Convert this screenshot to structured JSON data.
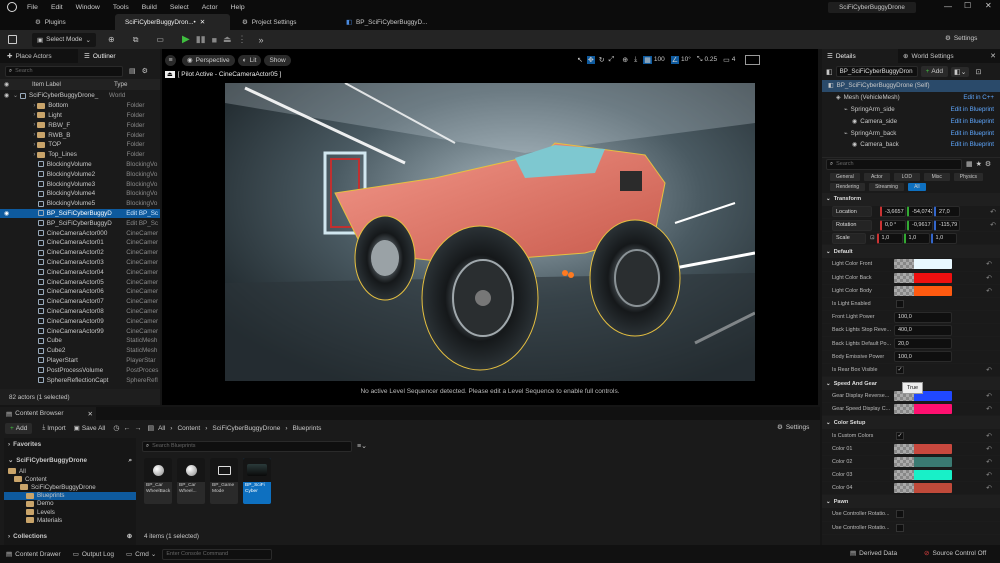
{
  "title_bar": {
    "menu": [
      "File",
      "Edit",
      "Window",
      "Tools",
      "Build",
      "Select",
      "Actor",
      "Help"
    ],
    "project_name": "SciFiCyberBuggyDrone",
    "tabs": [
      {
        "label": "Plugins"
      },
      {
        "label": "SciFiCyberBuggyDron...•"
      },
      {
        "label": "Project Settings"
      },
      {
        "label": "BP_SciFiCyberBuggyD..."
      }
    ]
  },
  "toolbar": {
    "select_mode": "Select Mode",
    "settings": "Settings"
  },
  "left_panel": {
    "tab_place": "Place Actors",
    "tab_outliner": "Outliner",
    "search_placeholder": "Search",
    "col_label": "Item Label",
    "col_type": "Type",
    "rows": [
      {
        "name": "SciFiCyberBuggyDrone_",
        "type": "World",
        "kind": "world",
        "indent": 0,
        "eye": true
      },
      {
        "name": "Bottom",
        "type": "Folder",
        "kind": "folder",
        "indent": 1
      },
      {
        "name": "Light",
        "type": "Folder",
        "kind": "folder",
        "indent": 1
      },
      {
        "name": "RBW_F",
        "type": "Folder",
        "kind": "folder",
        "indent": 1
      },
      {
        "name": "RWB_B",
        "type": "Folder",
        "kind": "folder",
        "indent": 1
      },
      {
        "name": "TOP",
        "type": "Folder",
        "kind": "folder",
        "indent": 1
      },
      {
        "name": "Top_Lines",
        "type": "Folder",
        "kind": "folder",
        "indent": 1
      },
      {
        "name": "BlockingVolume",
        "type": "BlockingVo",
        "kind": "actor",
        "indent": 1
      },
      {
        "name": "BlockingVolume2",
        "type": "BlockingVo",
        "kind": "actor",
        "indent": 1
      },
      {
        "name": "BlockingVolume3",
        "type": "BlockingVo",
        "kind": "actor",
        "indent": 1
      },
      {
        "name": "BlockingVolume4",
        "type": "BlockingVo",
        "kind": "actor",
        "indent": 1
      },
      {
        "name": "BlockingVolume5",
        "type": "BlockingVo",
        "kind": "actor",
        "indent": 1
      },
      {
        "name": "BP_SciFiCyberBuggyD",
        "type": "Edit BP_Sc",
        "kind": "actor",
        "indent": 1,
        "selected": true,
        "eye": true
      },
      {
        "name": "BP_SciFiCyberBuggyD",
        "type": "Edit BP_Sc",
        "kind": "actor",
        "indent": 1
      },
      {
        "name": "CineCameraActor000",
        "type": "CineCamer",
        "kind": "actor",
        "indent": 1
      },
      {
        "name": "CineCameraActor01",
        "type": "CineCamer",
        "kind": "actor",
        "indent": 1
      },
      {
        "name": "CineCameraActor02",
        "type": "CineCamer",
        "kind": "actor",
        "indent": 1
      },
      {
        "name": "CineCameraActor03",
        "type": "CineCamer",
        "kind": "actor",
        "indent": 1
      },
      {
        "name": "CineCameraActor04",
        "type": "CineCamer",
        "kind": "actor",
        "indent": 1
      },
      {
        "name": "CineCameraActor05",
        "type": "CineCamer",
        "kind": "actor",
        "indent": 1
      },
      {
        "name": "CineCameraActor06",
        "type": "CineCamer",
        "kind": "actor",
        "indent": 1
      },
      {
        "name": "CineCameraActor07",
        "type": "CineCamer",
        "kind": "actor",
        "indent": 1
      },
      {
        "name": "CineCameraActor08",
        "type": "CineCamer",
        "kind": "actor",
        "indent": 1
      },
      {
        "name": "CineCameraActor09",
        "type": "CineCamer",
        "kind": "actor",
        "indent": 1
      },
      {
        "name": "CineCameraActor99",
        "type": "CineCamer",
        "kind": "actor",
        "indent": 1
      },
      {
        "name": "Cube",
        "type": "StaticMesh",
        "kind": "actor",
        "indent": 1
      },
      {
        "name": "Cube2",
        "type": "StaticMesh",
        "kind": "actor",
        "indent": 1
      },
      {
        "name": "PlayerStart",
        "type": "PlayerStar",
        "kind": "actor",
        "indent": 1
      },
      {
        "name": "PostProcessVolume",
        "type": "PostProces",
        "kind": "actor",
        "indent": 1
      },
      {
        "name": "SphereReflectionCapt",
        "type": "SphereRefl",
        "kind": "actor",
        "indent": 1
      }
    ],
    "status": "82 actors (1 selected)"
  },
  "viewport": {
    "perspective": "Perspective",
    "lit": "Lit",
    "show": "Show",
    "pilot": "[ Pilot Active - CineCameraActor05 ]",
    "grid": "100",
    "angle": "10°",
    "scale": "0.25",
    "cams": "4",
    "message": "No active Level Sequencer detected. Please edit a Level Sequence to enable full controls."
  },
  "details": {
    "tab_details": "Details",
    "tab_world": "World Settings",
    "actor_name": "BP_SciFiCyberBuggyDron",
    "add": "Add",
    "components": [
      {
        "name": "BP_SciFiCyberBuggyDrone (Self)",
        "link": "",
        "indent": 0,
        "selected": true
      },
      {
        "name": "Mesh (VehicleMesh)",
        "link": "Edit in C++",
        "indent": 1
      },
      {
        "name": "SpringArm_side",
        "link": "Edit in Blueprint",
        "indent": 2
      },
      {
        "name": "Camera_side",
        "link": "Edit in Blueprint",
        "indent": 3
      },
      {
        "name": "SpringArm_back",
        "link": "Edit in Blueprint",
        "indent": 2
      },
      {
        "name": "Camera_back",
        "link": "Edit in Blueprint",
        "indent": 3
      }
    ],
    "search_placeholder": "Search",
    "filters": [
      "General",
      "Actor",
      "LOD",
      "Misc",
      "Physics",
      "Rendering",
      "Streaming",
      "All"
    ],
    "transform_label": "Transform",
    "location": {
      "label": "Location",
      "x": "-3,6657",
      "y": "-54,0742",
      "z": "27,0"
    },
    "rotation": {
      "label": "Rotation",
      "x": "0,0 °",
      "y": "-0,9617 °",
      "z": "-115,79"
    },
    "scale": {
      "label": "Scale",
      "x": "1,0",
      "y": "1,0",
      "z": "1,0"
    },
    "default_label": "Default",
    "default_rows": [
      {
        "label": "Light Color Front",
        "type": "color",
        "color": "#e8f8ff"
      },
      {
        "label": "Light Color Back",
        "type": "color",
        "color": "#f01010"
      },
      {
        "label": "Light Color Body",
        "type": "color",
        "color": "#ff5a10"
      },
      {
        "label": "Is Light Enabled",
        "type": "check",
        "checked": false
      },
      {
        "label": "Front Light Power",
        "type": "num",
        "value": "100,0"
      },
      {
        "label": "Back Lights Stop Reve...",
        "type": "num",
        "value": "400,0"
      },
      {
        "label": "Back Lights Default Po...",
        "type": "num",
        "value": "20,0"
      },
      {
        "label": "Body Emissive Power",
        "type": "num",
        "value": "100,0"
      },
      {
        "label": "Is Rear Box Visible",
        "type": "check",
        "checked": true
      }
    ],
    "tooltip": "True",
    "speed_label": "Speed And Gear",
    "speed_rows": [
      {
        "label": "Gear Display Reverse...",
        "color": "#2048ff"
      },
      {
        "label": "Gear Speed Display C...",
        "color": "#ff1070"
      }
    ],
    "color_setup_label": "Color Setup",
    "custom_colors_label": "Is Custom Colors",
    "color_rows": [
      {
        "label": "Color 01",
        "color": "#c8483e"
      },
      {
        "label": "Color 02",
        "color": "#3a7a72"
      },
      {
        "label": "Color 03",
        "color": "#18f0c8"
      },
      {
        "label": "Color 04",
        "color": "#c04a3a"
      }
    ],
    "pawn_label": "Pawn",
    "pawn_rows": [
      "Use Controller Rotatio...",
      "Use Controller Rotatio..."
    ]
  },
  "content_browser": {
    "tab": "Content Browser",
    "add": "Add",
    "import": "Import",
    "save_all": "Save All",
    "path": [
      "All",
      "Content",
      "SciFiCyberBuggyDrone",
      "Blueprints"
    ],
    "settings": "Settings",
    "favorites": "Favorites",
    "project": "SciFiCyberBuggyDrone",
    "tree": [
      {
        "label": "All",
        "indent": 0
      },
      {
        "label": "Content",
        "indent": 1
      },
      {
        "label": "SciFiCyberBuggyDrone",
        "indent": 2
      },
      {
        "label": "Blueprints",
        "indent": 3,
        "selected": true
      },
      {
        "label": "Demo",
        "indent": 3
      },
      {
        "label": "Levels",
        "indent": 3
      },
      {
        "label": "Materials",
        "indent": 3
      }
    ],
    "collections": "Collections",
    "search_placeholder": "Search Blueprints",
    "assets": [
      {
        "label": "BP_Car WheelBack",
        "icon": "sphere"
      },
      {
        "label": "BP_Car Wheel...",
        "icon": "sphere"
      },
      {
        "label": "BP_Game Mode",
        "icon": "monitor"
      },
      {
        "label": "BP_SciFi Cyber",
        "icon": "car",
        "selected": true
      }
    ],
    "count": "4 items (1 selected)"
  },
  "status_bar": {
    "drawer": "Content Drawer",
    "log": "Output Log",
    "cmd": "Cmd",
    "console_placeholder": "Enter Console Command",
    "derived": "Derived Data",
    "source": "Source Control Off"
  }
}
